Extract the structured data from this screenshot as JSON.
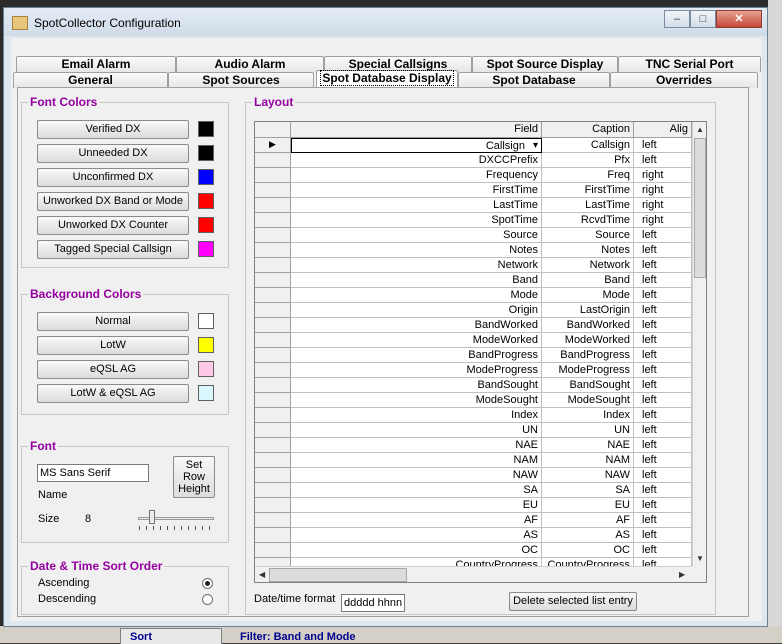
{
  "window": {
    "title": "SpotCollector Configuration"
  },
  "tabs_back": [
    "Email Alarm",
    "Audio Alarm",
    "Special Callsigns",
    "Spot Source Display",
    "TNC Serial Port"
  ],
  "tabs_front": [
    "General",
    "Spot Sources",
    "Spot Database Display",
    "Spot Database",
    "Overrides"
  ],
  "font_colors": {
    "legend": "Font Colors",
    "items": [
      {
        "label": "Verified DX",
        "color": "#000000"
      },
      {
        "label": "Unneeded DX",
        "color": "#000000"
      },
      {
        "label": "Unconfirmed DX",
        "color": "#0000ff"
      },
      {
        "label": "Unworked DX Band or Mode",
        "color": "#ff0000"
      },
      {
        "label": "Unworked DX Counter",
        "color": "#ff0000"
      },
      {
        "label": "Tagged Special Callsign",
        "color": "#ff00ff"
      }
    ]
  },
  "background_colors": {
    "legend": "Background Colors",
    "items": [
      {
        "label": "Normal",
        "color": "#ffffff"
      },
      {
        "label": "LotW",
        "color": "#ffff00"
      },
      {
        "label": "eQSL AG",
        "color": "#ffc8e6"
      },
      {
        "label": "LotW & eQSL AG",
        "color": "#d8f6fb"
      }
    ]
  },
  "font": {
    "legend": "Font",
    "name_value": "MS Sans Serif",
    "name_label": "Name",
    "size_label": "Size",
    "size_value": "8",
    "set_row_height": "Set Row Height",
    "slider_fraction": 0.15
  },
  "sort": {
    "legend": "Date & Time Sort Order",
    "ascending": "Ascending",
    "descending": "Descending",
    "selected": "ascending"
  },
  "layout": {
    "legend": "Layout",
    "headers": {
      "field": "Field",
      "caption": "Caption",
      "align": "Alig"
    },
    "rows": [
      [
        "Callsign",
        "Callsign",
        "left"
      ],
      [
        "DXCCPrefix",
        "Pfx",
        "left"
      ],
      [
        "Frequency",
        "Freq",
        "right"
      ],
      [
        "FirstTime",
        "FirstTime",
        "right"
      ],
      [
        "LastTime",
        "LastTime",
        "right"
      ],
      [
        "SpotTime",
        "RcvdTime",
        "right"
      ],
      [
        "Source",
        "Source",
        "left"
      ],
      [
        "Notes",
        "Notes",
        "left"
      ],
      [
        "Network",
        "Network",
        "left"
      ],
      [
        "Band",
        "Band",
        "left"
      ],
      [
        "Mode",
        "Mode",
        "left"
      ],
      [
        "Origin",
        "LastOrigin",
        "left"
      ],
      [
        "BandWorked",
        "BandWorked",
        "left"
      ],
      [
        "ModeWorked",
        "ModeWorked",
        "left"
      ],
      [
        "BandProgress",
        "BandProgress",
        "left"
      ],
      [
        "ModeProgress",
        "ModeProgress",
        "left"
      ],
      [
        "BandSought",
        "BandSought",
        "left"
      ],
      [
        "ModeSought",
        "ModeSought",
        "left"
      ],
      [
        "Index",
        "Index",
        "left"
      ],
      [
        "UN",
        "UN",
        "left"
      ],
      [
        "NAE",
        "NAE",
        "left"
      ],
      [
        "NAM",
        "NAM",
        "left"
      ],
      [
        "NAW",
        "NAW",
        "left"
      ],
      [
        "SA",
        "SA",
        "left"
      ],
      [
        "EU",
        "EU",
        "left"
      ],
      [
        "AF",
        "AF",
        "left"
      ],
      [
        "AS",
        "AS",
        "left"
      ],
      [
        "OC",
        "OC",
        "left"
      ],
      [
        "CountryProgress",
        "CountryProgress",
        "left"
      ]
    ],
    "date_format_label": "Date/time format",
    "date_format_value": "ddddd hhnn",
    "delete_button": "Delete selected list entry"
  },
  "background_app": {
    "sort_tab": "Sort",
    "filter_label": "Filter: Band and Mode"
  }
}
